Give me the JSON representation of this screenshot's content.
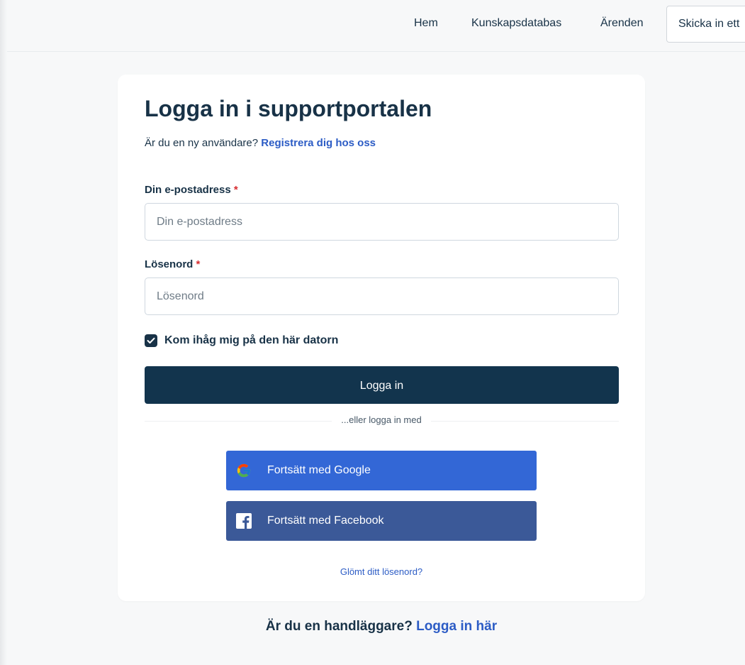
{
  "nav": {
    "home": "Hem",
    "knowledge_base": "Kunskapsdatabas",
    "tickets": "Ärenden",
    "submit": "Skicka in ett"
  },
  "login": {
    "title": "Logga in i supportportalen",
    "new_user_prompt": "Är du en ny användare?",
    "register_link": "Registrera dig hos oss",
    "email_label": "Din e-postadress",
    "email_placeholder": "Din e-postadress",
    "email_value": "",
    "password_label": "Lösenord",
    "password_placeholder": "Lösenord",
    "password_value": "",
    "required_marker": "*",
    "remember_me_label": "Kom ihåg mig på den här datorn",
    "remember_me_checked": true,
    "submit_label": "Logga in",
    "divider_text": "...eller logga in med",
    "google_label": "Fortsätt med Google",
    "facebook_label": "Fortsätt med Facebook",
    "forgot_password": "Glömt ditt lösenord?"
  },
  "agent": {
    "prompt": "Är du en handläggare?",
    "link": "Logga in här"
  },
  "colors": {
    "primary": "#12344d",
    "link": "#2c5cc5",
    "google": "#3367d6",
    "facebook": "#3b5998",
    "required": "#d72d30"
  },
  "icons": {
    "checkbox": "check-icon",
    "google": "google-icon",
    "facebook": "facebook-icon"
  }
}
